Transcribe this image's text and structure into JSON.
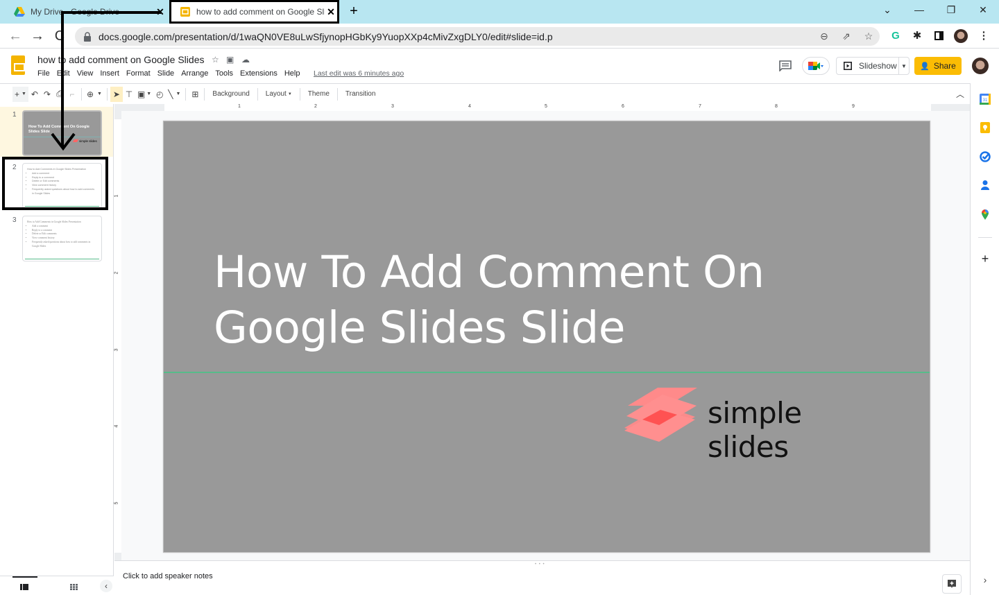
{
  "browser": {
    "tabs": [
      {
        "label": "My Drive - Google Drive",
        "favicon": "google-drive-icon",
        "active": false
      },
      {
        "label": "how to add comment on Google Slides",
        "favicon": "google-slides-icon",
        "active": true
      }
    ],
    "new_tab_label": "+",
    "window_controls": {
      "tab_search": "⌄",
      "minimize": "—",
      "restore": "❐",
      "close": "✕"
    },
    "url": "docs.google.com/presentation/d/1waQN0VE8uLwSfjynopHGbKy9YuopXXp4cMivZxgDLY0/edit#slide=id.p",
    "nav": {
      "back": "←",
      "forward": "→",
      "reload": "C"
    }
  },
  "doc": {
    "title": "how to add comment on Google Slides",
    "menu": [
      "File",
      "Edit",
      "View",
      "Insert",
      "Format",
      "Slide",
      "Arrange",
      "Tools",
      "Extensions",
      "Help"
    ],
    "last_edit": "Last edit was 6 minutes ago",
    "slideshow_label": "Slideshow",
    "share_label": "Share"
  },
  "toolbar": {
    "background": "Background",
    "layout": "Layout",
    "theme": "Theme",
    "transition": "Transition"
  },
  "filmstrip": {
    "slides": [
      {
        "number": "1",
        "title": "How To Add Comment On Google Slides Slide",
        "logo": "simple slides"
      },
      {
        "number": "2",
        "title": "How to Add Comments in Google Slides Presentation",
        "bullets": [
          "Add a comment",
          "Reply to a comment",
          "Delete or Edit comments",
          "View comment history",
          "Frequently asked questions about how to add comments in Google Slides"
        ]
      },
      {
        "number": "3",
        "title": "How to Add Comments in Google Slides Presentation",
        "bullets": [
          "Add a comment",
          "Reply to a comment",
          "Delete or Edit comments",
          "View comment history",
          "Frequently asked questions about how to add comments in Google Slides"
        ]
      }
    ],
    "selected_index": 0
  },
  "ruler": {
    "horizontal": [
      "1",
      "2",
      "3",
      "4",
      "5",
      "6",
      "7",
      "8",
      "9"
    ],
    "vertical": [
      "1",
      "2",
      "3",
      "4",
      "5"
    ]
  },
  "slide": {
    "title_line1": "How To Add Comment On",
    "title_line2": "Google Slides Slide",
    "logo_text": "simple slides",
    "background_color": "#999999",
    "divider_color": "#57bb8a",
    "logo_colors": [
      "#ff8a8a",
      "#ff5252"
    ]
  },
  "notes": {
    "placeholder": "Click to add speaker notes"
  },
  "colors": {
    "tabstrip_bg": "#b8e6f1",
    "share_bg": "#fbbc04",
    "slides_brand": "#f4b400",
    "selected_thumb_bg": "#fef7e0"
  }
}
